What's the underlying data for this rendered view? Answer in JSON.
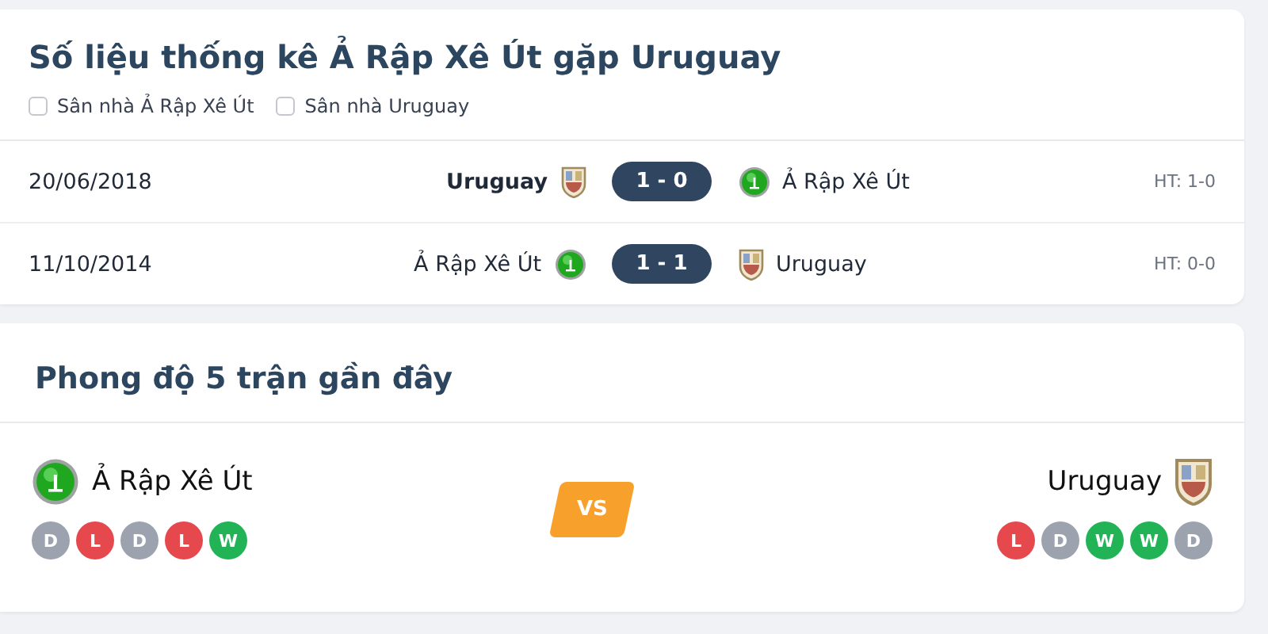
{
  "head_to_head": {
    "title": "Số liệu thống kê Ả Rập Xê Út gặp Uruguay",
    "filters": [
      {
        "label": "Sân nhà Ả Rập Xê Út",
        "checked": false
      },
      {
        "label": "Sân nhà Uruguay",
        "checked": false
      }
    ],
    "matches": [
      {
        "date": "20/06/2018",
        "home": {
          "name": "Uruguay",
          "kind": "shield",
          "winner": true
        },
        "score": "1 - 0",
        "away": {
          "name": "Ả Rập Xê Út",
          "kind": "ball",
          "winner": false
        },
        "half_time": "HT: 1-0"
      },
      {
        "date": "11/10/2014",
        "home": {
          "name": "Ả Rập Xê Út",
          "kind": "ball",
          "winner": false
        },
        "score": "1 - 1",
        "away": {
          "name": "Uruguay",
          "kind": "shield",
          "winner": false
        },
        "half_time": "HT: 0-0"
      }
    ]
  },
  "form": {
    "title": "Phong độ 5 trận gần đây",
    "vs": "VS",
    "teams": [
      {
        "name": "Ả Rập Xê Út",
        "kind": "ball",
        "results": [
          {
            "label": "D",
            "color": "#9ca3af"
          },
          {
            "label": "L",
            "color": "#e5484d"
          },
          {
            "label": "D",
            "color": "#9ca3af"
          },
          {
            "label": "L",
            "color": "#e5484d"
          },
          {
            "label": "W",
            "color": "#22b357"
          }
        ]
      },
      {
        "name": "Uruguay",
        "kind": "shield",
        "results": [
          {
            "label": "L",
            "color": "#e5484d"
          },
          {
            "label": "D",
            "color": "#9ca3af"
          },
          {
            "label": "W",
            "color": "#22b357"
          },
          {
            "label": "W",
            "color": "#22b357"
          },
          {
            "label": "D",
            "color": "#9ca3af"
          }
        ]
      }
    ]
  }
}
